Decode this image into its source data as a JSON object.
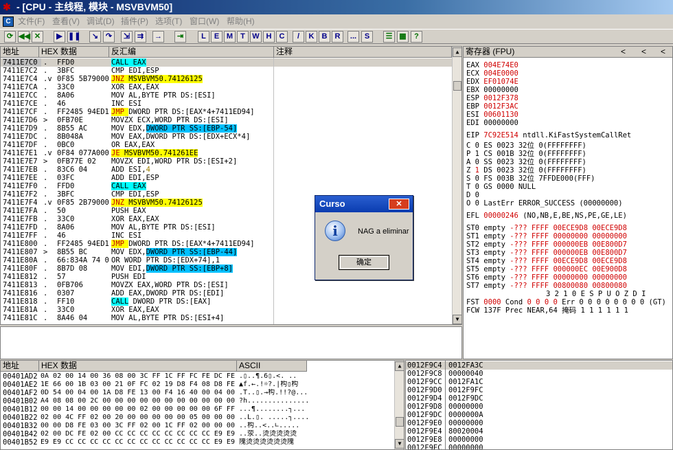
{
  "window": {
    "title": "- [CPU - 主线程, 模块 - MSVBVM50]"
  },
  "menu": [
    "文件(F)",
    "查看(V)",
    "调试(D)",
    "插件(P)",
    "选项(T)",
    "窗口(W)",
    "帮助(H)"
  ],
  "toolbar": {
    "letters": [
      "L",
      "E",
      "M",
      "T",
      "W",
      "H",
      "C",
      "/",
      "K",
      "B",
      "R",
      "...",
      "S"
    ]
  },
  "cpu_headers": {
    "address": "地址",
    "hex": "HEX 数据",
    "disasm": "反汇编",
    "comment": "注释"
  },
  "disasm_rows": [
    {
      "addr": "7411E7C0",
      "mark": ".",
      "hex": "FFD0",
      "asm": "CALL EAX",
      "style": "call",
      "selected": true
    },
    {
      "addr": "7411E7C2",
      "mark": ".",
      "hex": "3BFC",
      "asm": "CMP EDI,ESP"
    },
    {
      "addr": "7411E7C4",
      "mark": ".v",
      "hex": "0F85 5B790000",
      "asm_op": "JNZ",
      "asm_arg": "MSVBVM50.74126125",
      "style": "jmp"
    },
    {
      "addr": "7411E7CA",
      "mark": ".",
      "hex": "33C0",
      "asm": "XOR EAX,EAX"
    },
    {
      "addr": "7411E7CC",
      "mark": ".",
      "hex": "8A06",
      "asm": "MOV AL,BYTE PTR DS:[ESI]"
    },
    {
      "addr": "7411E7CE",
      "mark": ".",
      "hex": "46",
      "asm": "INC ESI"
    },
    {
      "addr": "7411E7CF",
      "mark": ".",
      "hex": "FF2485 94ED117",
      "asm_op": "JMP",
      "asm_arg": "DWORD PTR DS:[EAX*4+7411ED94]",
      "style": "jmp-op"
    },
    {
      "addr": "7411E7D6",
      "mark": ">",
      "hex": "0FB70E",
      "asm": "MOVZX ECX,WORD PTR DS:[ESI]"
    },
    {
      "addr": "7411E7D9",
      "mark": ".",
      "hex": "8B55 AC",
      "asm_op": "MOV EDX,",
      "asm_arg": "DWORD PTR SS:[EBP-54]",
      "style": "ss"
    },
    {
      "addr": "7411E7DC",
      "mark": ".",
      "hex": "8B048A",
      "asm": "MOV EAX,DWORD PTR DS:[EDX+ECX*4]"
    },
    {
      "addr": "7411E7DF",
      "mark": ".",
      "hex": "0BC0",
      "asm": "OR EAX,EAX"
    },
    {
      "addr": "7411E7E1",
      "mark": ".v",
      "hex": "0F84 077A0000",
      "asm_op": "JE",
      "asm_arg": "MSVBVM50.741261EE",
      "style": "jmp"
    },
    {
      "addr": "7411E7E7",
      "mark": ">",
      "hex": "0FB77E 02",
      "asm": "MOVZX EDI,WORD PTR DS:[ESI+2]"
    },
    {
      "addr": "7411E7EB",
      "mark": ".",
      "hex": "83C6 04",
      "asm_op": "ADD ESI,",
      "asm_arg": "4",
      "style": "imm"
    },
    {
      "addr": "7411E7EE",
      "mark": ".",
      "hex": "03FC",
      "asm": "ADD EDI,ESP"
    },
    {
      "addr": "7411E7F0",
      "mark": ".",
      "hex": "FFD0",
      "asm": "CALL EAX",
      "style": "call"
    },
    {
      "addr": "7411E7F2",
      "mark": ".",
      "hex": "3BFC",
      "asm": "CMP EDI,ESP"
    },
    {
      "addr": "7411E7F4",
      "mark": ".v",
      "hex": "0F85 2B790000",
      "asm_op": "JNZ",
      "asm_arg": "MSVBVM50.74126125",
      "style": "jmp"
    },
    {
      "addr": "7411E7FA",
      "mark": ".",
      "hex": "50",
      "asm": "PUSH EAX"
    },
    {
      "addr": "7411E7FB",
      "mark": ".",
      "hex": "33C0",
      "asm": "XOR EAX,EAX"
    },
    {
      "addr": "7411E7FD",
      "mark": ".",
      "hex": "8A06",
      "asm": "MOV AL,BYTE PTR DS:[ESI]"
    },
    {
      "addr": "7411E7FF",
      "mark": ".",
      "hex": "46",
      "asm": "INC ESI"
    },
    {
      "addr": "7411E800",
      "mark": ".",
      "hex": "FF2485 94ED117",
      "asm_op": "JMP",
      "asm_arg": "DWORD PTR DS:[EAX*4+7411ED94]",
      "style": "jmp-op"
    },
    {
      "addr": "7411E807",
      "mark": ">",
      "hex": "8B55 BC",
      "asm_op": "MOV EDX,",
      "asm_arg": "DWORD PTR SS:[EBP-44]",
      "style": "ss"
    },
    {
      "addr": "7411E80A",
      "mark": ".",
      "hex": "66:834A 74 01",
      "asm": "OR WORD PTR DS:[EDX+74],1"
    },
    {
      "addr": "7411E80F",
      "mark": ".",
      "hex": "8B7D 08",
      "asm_op": "MOV EDI,",
      "asm_arg": "DWORD PTR SS:[EBP+8]",
      "style": "ss"
    },
    {
      "addr": "7411E812",
      "mark": ".",
      "hex": "57",
      "asm": "PUSH EDI"
    },
    {
      "addr": "7411E813",
      "mark": ".",
      "hex": "0FB706",
      "asm": "MOVZX EAX,WORD PTR DS:[ESI]"
    },
    {
      "addr": "7411E816",
      "mark": ".",
      "hex": "0307",
      "asm": "ADD EAX,DWORD PTR DS:[EDI]"
    },
    {
      "addr": "7411E818",
      "mark": ".",
      "hex": "FF10",
      "asm_op": "CALL",
      "asm_arg": " DWORD PTR DS:[EAX]",
      "style": "call-op"
    },
    {
      "addr": "7411E81A",
      "mark": ".",
      "hex": "33C0",
      "asm": "XOR EAX,EAX"
    },
    {
      "addr": "7411E81C",
      "mark": ".",
      "hex": "8A46 04",
      "asm": "MOV AL,BYTE PTR DS:[ESI+4]"
    }
  ],
  "registers": {
    "header": "寄存器 (FPU)",
    "general": [
      {
        "name": "EAX",
        "value": "004E74E0"
      },
      {
        "name": "ECX",
        "value": "004E0000"
      },
      {
        "name": "EDX",
        "value": "EF01074E"
      },
      {
        "name": "EBX",
        "value": "00000000"
      },
      {
        "name": "ESP",
        "value": "0012F378"
      },
      {
        "name": "EBP",
        "value": "0012F3AC"
      },
      {
        "name": "ESI",
        "value": "00601130"
      },
      {
        "name": "EDI",
        "value": "00000000"
      }
    ],
    "eip": {
      "name": "EIP",
      "value": "7C92E514",
      "desc": "ntdll.KiFastSystemCallRet"
    },
    "flags": [
      "C 0   ES 0023 32位 0(FFFFFFFF)",
      "P 1   CS 001B 32位 0(FFFFFFFF)",
      "A 0   SS 0023 32位 0(FFFFFFFF)",
      "Z 1   DS 0023 32位 0(FFFFFFFF)",
      "S 0   FS 003B 32位 7FFDE000(FFF)",
      "T 0   GS 0000 NULL",
      "D 0",
      "O 0   LastErr ERROR_SUCCESS (00000000)"
    ],
    "efl": {
      "name": "EFL",
      "value": "00000246",
      "desc": "(NO,NB,E,BE,NS,PE,GE,LE)"
    },
    "fpu": [
      {
        "name": "ST0",
        "tag": "empty",
        "v1": "-???",
        "v2": "FFFF",
        "v3": "00ECE9D8",
        "v4": "00ECE9D8"
      },
      {
        "name": "ST1",
        "tag": "empty",
        "v1": "-???",
        "v2": "FFFF",
        "v3": "00000000",
        "v4": "00000000"
      },
      {
        "name": "ST2",
        "tag": "empty",
        "v1": "-???",
        "v2": "FFFF",
        "v3": "000000EB",
        "v4": "00E800D7"
      },
      {
        "name": "ST3",
        "tag": "empty",
        "v1": "-???",
        "v2": "FFFF",
        "v3": "000000EB",
        "v4": "00E800D7"
      },
      {
        "name": "ST4",
        "tag": "empty",
        "v1": "-???",
        "v2": "FFFF",
        "v3": "00ECE9D8",
        "v4": "00ECE9D8"
      },
      {
        "name": "ST5",
        "tag": "empty",
        "v1": "-???",
        "v2": "FFFF",
        "v3": "000000EC",
        "v4": "00E900D8"
      },
      {
        "name": "ST6",
        "tag": "empty",
        "v1": "-???",
        "v2": "FFFF",
        "v3": "00000000",
        "v4": "00000000"
      },
      {
        "name": "ST7",
        "tag": "empty",
        "v1": "-???",
        "v2": "FFFF",
        "v3": "00800080",
        "v4": "00800080"
      }
    ],
    "fpu_bits_header": "3 2 1 0      E S P U O Z D I",
    "fst": {
      "name": "FST",
      "value": "0000",
      "cond_label": "Cond",
      "cond": "0 0 0 0",
      "err_label": "Err",
      "err": "0 0 0 0 0 0 0 0",
      "gt": "(GT)"
    },
    "fcw": {
      "name": "FCW",
      "value": "137F",
      "prec_label": "Prec",
      "prec": "NEAR,64",
      "mask_label": "掩码",
      "mask": "1 1 1 1 1 1"
    }
  },
  "dump_headers": {
    "address": "地址",
    "hex": "HEX 数据",
    "ascii": "ASCII"
  },
  "dump_rows": [
    {
      "addr": "00401AD2",
      "hex": "0A 02 00 14 00 36 08 00 3C FF 1C FF FC FE DC FE",
      "ascii": ".▯..¶.6▯.<.  .. "
    },
    {
      "addr": "00401AE2",
      "hex": "1E 66 00 1B 03 00 21 0F FC 02 19 D8 F4 08 D8 FE",
      "ascii": "▲f.←.!☼?.|构▯构 "
    },
    {
      "addr": "00401AF2",
      "hex": "0D 54 00 04 00 1A D8 FE 13 00 F4 16 40 00 04 00",
      "ascii": ".T..▯.→构.!!?@..."
    },
    {
      "addr": "00401B02",
      "hex": "A4 08 08 00 2C 00 00 00 00 00 00 00 00 00 00 00",
      "ascii": "?h..............."
    },
    {
      "addr": "00401B12",
      "hex": "00 00 14 00 00 00 00 00 02 00 00 00 00 00 6F FF",
      "ascii": "...¶........┐..."
    },
    {
      "addr": "00401B22",
      "hex": "02 00 4C FF 02 00 20 00 00 00 00 00 05 00 00 00",
      "ascii": "..L.▯. .....┐...."
    },
    {
      "addr": "00401B32",
      "hex": "00 00 D8 FE 03 00 3C FF 02 00 1C FF 02 00 00 00",
      "ascii": "..构..<..∟....."
    },
    {
      "addr": "00401B42",
      "hex": "02 00 DC FE 02 00 CC CC CC CC CC CC CC CC E9 E9",
      "ascii": "..荥..烫烫烫烫烫"
    },
    {
      "addr": "00401B52",
      "hex": "E9 E9 CC CC CC CC CC CC CC CC CC CC CC CC E9 E9",
      "ascii": "隗烫烫烫烫烫烫隗"
    }
  ],
  "stack_rows": [
    {
      "addr": "0012F9C4",
      "value": "0012FA3C"
    },
    {
      "addr": "0012F9C8",
      "value": "00000040"
    },
    {
      "addr": "0012F9CC",
      "value": "0012FA1C"
    },
    {
      "addr": "0012F9D0",
      "value": "0012F9FC"
    },
    {
      "addr": "0012F9D4",
      "value": "0012F9DC"
    },
    {
      "addr": "0012F9D8",
      "value": "00000000"
    },
    {
      "addr": "0012F9DC",
      "value": "0000000A"
    },
    {
      "addr": "0012F9E0",
      "value": "00000000"
    },
    {
      "addr": "0012F9E4",
      "value": "80020004"
    },
    {
      "addr": "0012F9E8",
      "value": "00000000"
    },
    {
      "addr": "0012F9EC",
      "value": "00000000"
    }
  ],
  "dialog": {
    "title": "Curso",
    "close": "✕",
    "message": "NAG a eliminar",
    "ok": "确定"
  },
  "colors": {
    "selection": "#00ffff",
    "jump_highlight": "#ffff00",
    "stack_ref": "#00c0ff",
    "changed_reg": "#d00000"
  }
}
